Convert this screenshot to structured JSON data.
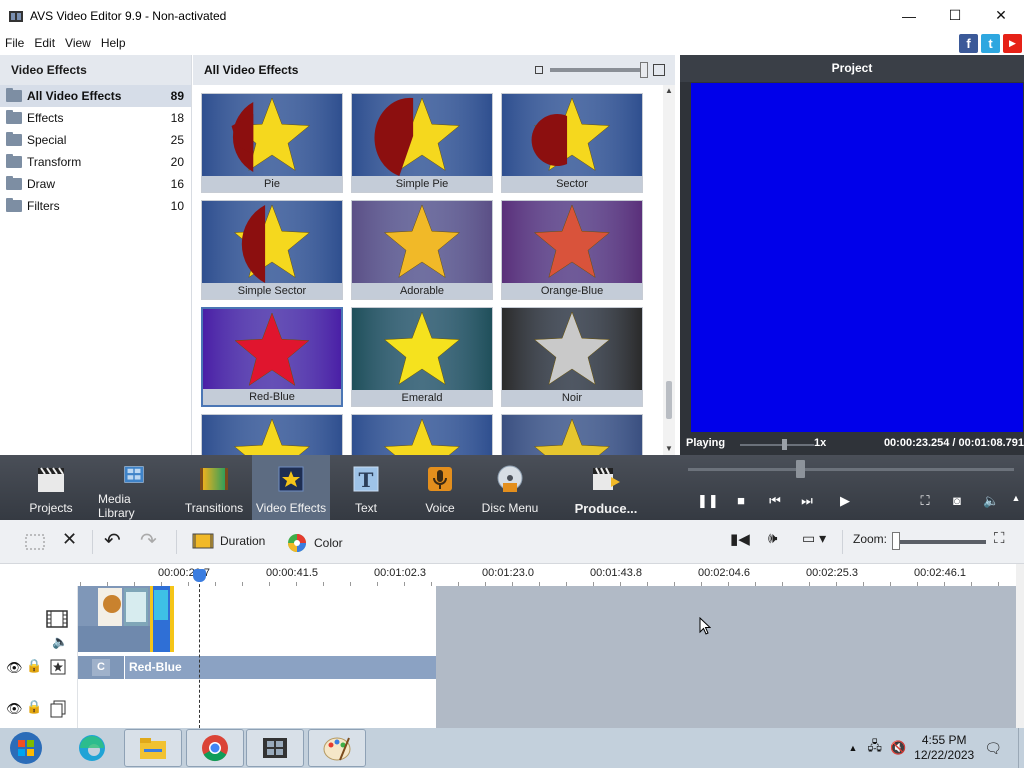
{
  "window": {
    "title": "AVS Video Editor 9.9 - Non-activated",
    "minimize": "—",
    "maximize": "☐",
    "close": "✕"
  },
  "menu": [
    "File",
    "Edit",
    "View",
    "Help"
  ],
  "social": [
    {
      "icon": "facebook-icon",
      "glyph": "f",
      "color": "#3b5998"
    },
    {
      "icon": "twitter-icon",
      "glyph": "t",
      "color": "#2ea7e0"
    },
    {
      "icon": "youtube-icon",
      "glyph": "▶",
      "color": "#e62117"
    }
  ],
  "left_panel": {
    "title": "Video Effects",
    "categories": [
      {
        "name": "All Video Effects",
        "count": "89",
        "selected": true
      },
      {
        "name": "Effects",
        "count": "18"
      },
      {
        "name": "Special",
        "count": "25"
      },
      {
        "name": "Transform",
        "count": "20"
      },
      {
        "name": "Draw",
        "count": "16"
      },
      {
        "name": "Filters",
        "count": "10"
      }
    ]
  },
  "effects_panel": {
    "title": "All Video Effects",
    "tiles": [
      {
        "label": "Pie",
        "style": "pie",
        "bg": "#2f4f8f"
      },
      {
        "label": "Simple Pie",
        "style": "simplepie",
        "bg": "#2f4f8f"
      },
      {
        "label": "Sector",
        "style": "sector",
        "bg": "#2f4f8f"
      },
      {
        "label": "Simple Sector",
        "style": "simplesector",
        "bg": "#2f4f8f"
      },
      {
        "label": "Adorable",
        "style": "plain",
        "bg": "#5b4f86",
        "star": "#f1b928"
      },
      {
        "label": "Orange-Blue",
        "style": "plain",
        "bg": "#5a2f7a",
        "star": "#d9533b"
      },
      {
        "label": "Red-Blue",
        "style": "plain",
        "bg": "#4a1fa6",
        "star": "#e0152e",
        "selected": true
      },
      {
        "label": "Emerald",
        "style": "plain",
        "bg": "#1f4f5a",
        "star": "#f5e21e"
      },
      {
        "label": "Noir",
        "style": "plain",
        "bg": "#2a2a2a",
        "star": "#c9c9c9"
      },
      {
        "label": "",
        "style": "plain",
        "bg": "#2f4f8f",
        "star": "#f5d81e"
      },
      {
        "label": "",
        "style": "plain",
        "bg": "#2f4f8f",
        "star": "#f5d81e"
      },
      {
        "label": "",
        "style": "plain",
        "bg": "#3a4f80",
        "star": "#e6c62e"
      }
    ]
  },
  "preview": {
    "title": "Project",
    "status": "Playing",
    "speed": "1x",
    "time": "00:00:23.254 / 00:01:08.791",
    "screen_color": "#0000ea"
  },
  "toolbar": {
    "buttons": [
      {
        "label": "Projects",
        "icon": "clapperboard-icon"
      },
      {
        "label": "Media Library",
        "icon": "film-icon"
      },
      {
        "label": "Transitions",
        "icon": "transition-icon"
      },
      {
        "label": "Video Effects",
        "icon": "star-icon",
        "active": true
      },
      {
        "label": "Text",
        "icon": "text-icon"
      },
      {
        "label": "Voice",
        "icon": "microphone-icon"
      },
      {
        "label": "Disc Menu",
        "icon": "disc-icon"
      },
      {
        "label": "Produce...",
        "icon": "produce-icon"
      }
    ]
  },
  "timeline_toolbar": {
    "duration": "Duration",
    "color": "Color",
    "zoom": "Zoom:"
  },
  "ruler": [
    "00:00:20.7",
    "00:00:41.5",
    "00:01:02.3",
    "00:01:23.0",
    "00:01:43.8",
    "00:02:04.6",
    "00:02:25.3",
    "00:02:46.1"
  ],
  "tracks": {
    "effect_clip": "Red-Blue",
    "effect_tag": "C"
  },
  "taskbar": {
    "time": "4:55 PM",
    "date": "12/22/2023"
  }
}
